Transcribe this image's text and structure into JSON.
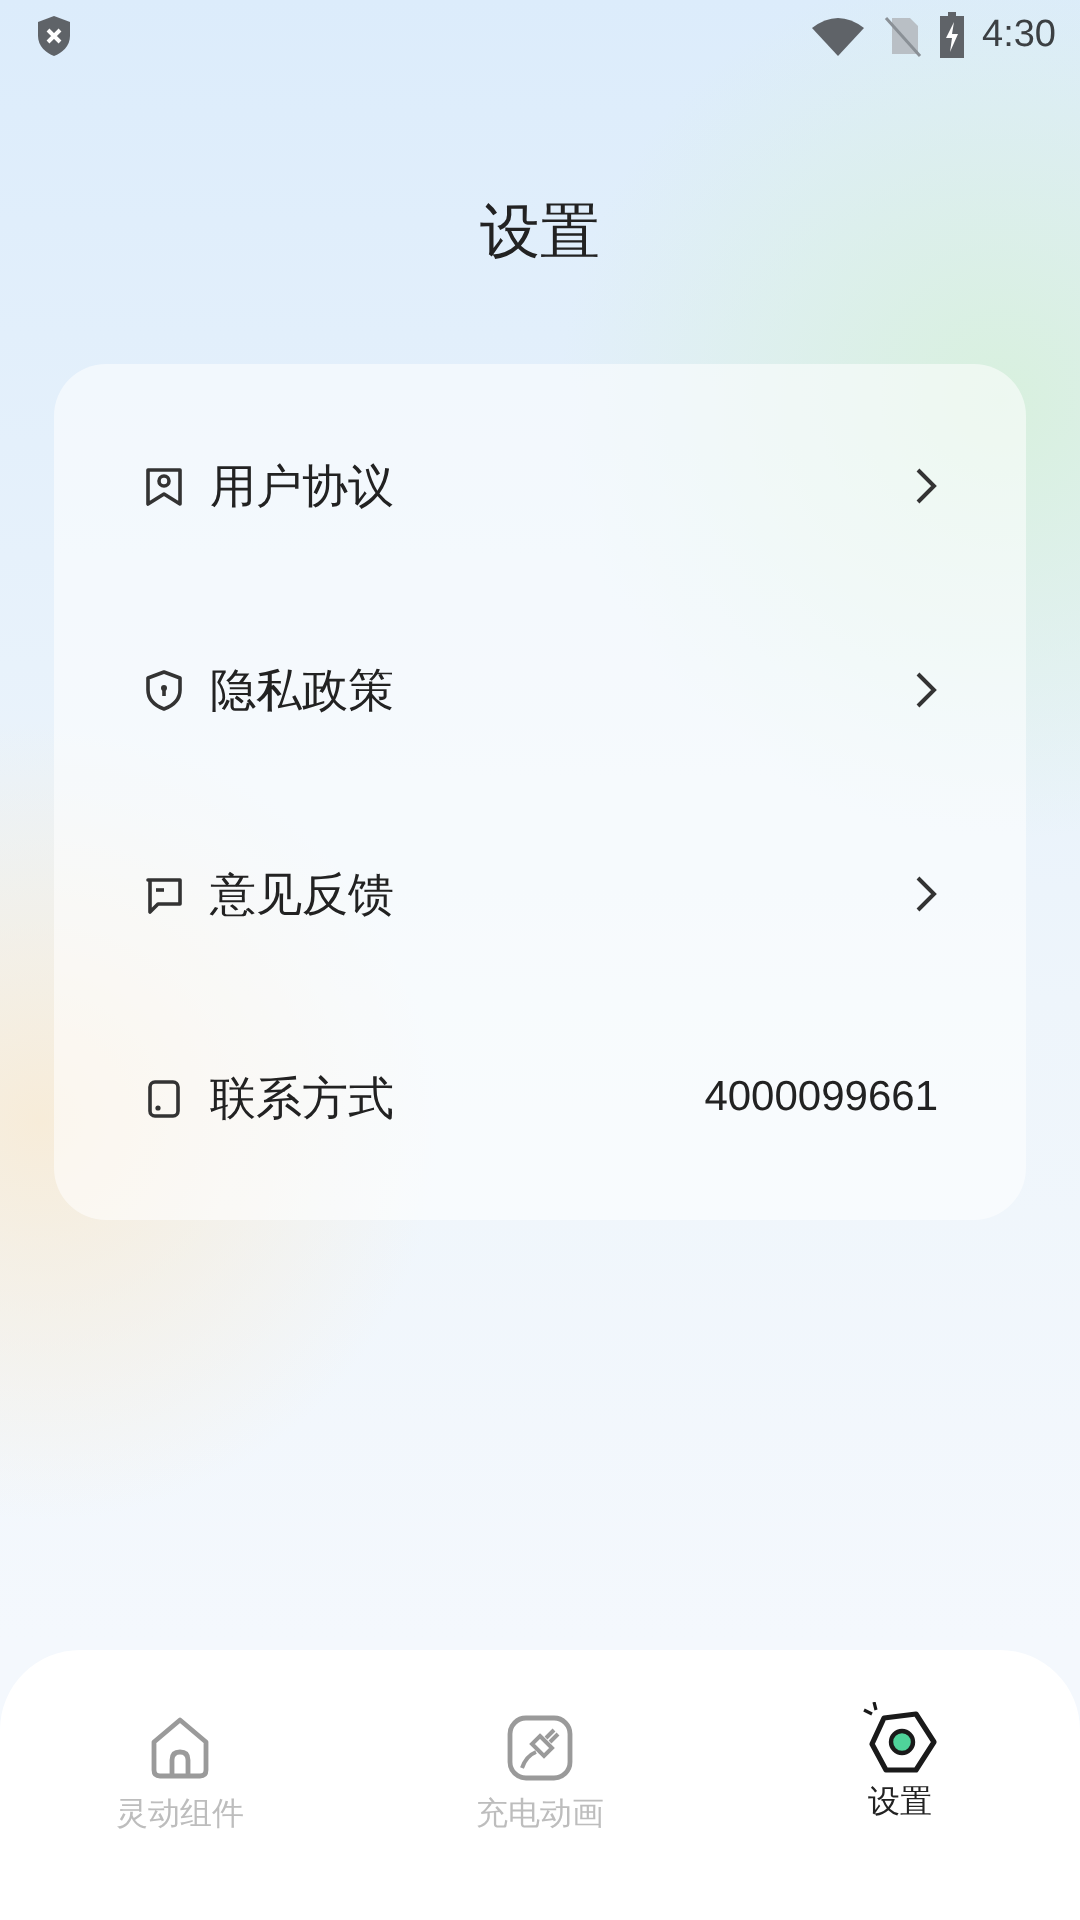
{
  "status_bar": {
    "time": "4:30"
  },
  "title": "设置",
  "items": [
    {
      "kind": "link",
      "label": "用户协议"
    },
    {
      "kind": "link",
      "label": "隐私政策"
    },
    {
      "kind": "link",
      "label": "意见反馈"
    },
    {
      "kind": "value",
      "label": "联系方式",
      "value": "4000099661"
    }
  ],
  "tabs": [
    {
      "label": "灵动组件",
      "selected": false
    },
    {
      "label": "充电动画",
      "selected": false
    },
    {
      "label": "设置",
      "selected": true
    }
  ]
}
